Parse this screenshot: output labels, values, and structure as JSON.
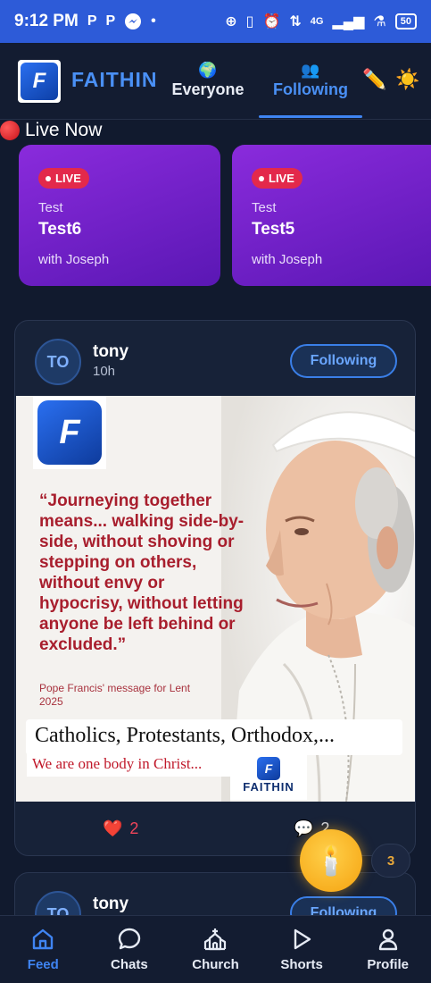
{
  "status_bar": {
    "time": "9:12 PM",
    "left_icons": [
      "P",
      "P"
    ],
    "network": "4G",
    "battery": "50"
  },
  "header": {
    "brand": "FAITHIN",
    "tabs": [
      {
        "emoji": "🌍",
        "label": "Everyone"
      },
      {
        "emoji": "👥",
        "label": "Following"
      }
    ],
    "pencil_emoji": "✏️",
    "sun_emoji": "☀️"
  },
  "live": {
    "section_title": "Live Now",
    "cards": [
      {
        "badge": "LIVE",
        "category": "Test",
        "title": "Test6",
        "host": "with Joseph"
      },
      {
        "badge": "LIVE",
        "category": "Test",
        "title": "Test5",
        "host": "with Joseph"
      }
    ]
  },
  "posts": [
    {
      "avatar": "TO",
      "author": "tony",
      "time": "10h",
      "follow_label": "Following",
      "image": {
        "quote": "“Journeying together means... walking side-by-side, without shoving or stepping on others, without envy or hypocrisy, without letting anyone be left behind or excluded.”",
        "source": "Pope Francis' message for Lent 2025",
        "caption": "Catholics, Protestants, Orthodox,...",
        "sub_caption": "We are one body in Christ...",
        "watermark": "FAITHIN"
      },
      "likes": "2",
      "comments": "2"
    },
    {
      "avatar": "TO",
      "author": "tony",
      "follow_label": "Following"
    }
  ],
  "candle": {
    "emoji": "🕯️",
    "count": "3"
  },
  "nav": [
    {
      "label": "Feed",
      "icon": "home-icon",
      "active": true
    },
    {
      "label": "Chats",
      "icon": "chat-bubble-icon"
    },
    {
      "label": "Church",
      "icon": "church-icon"
    },
    {
      "label": "Shorts",
      "icon": "play-icon"
    },
    {
      "label": "Profile",
      "icon": "person-icon"
    }
  ]
}
